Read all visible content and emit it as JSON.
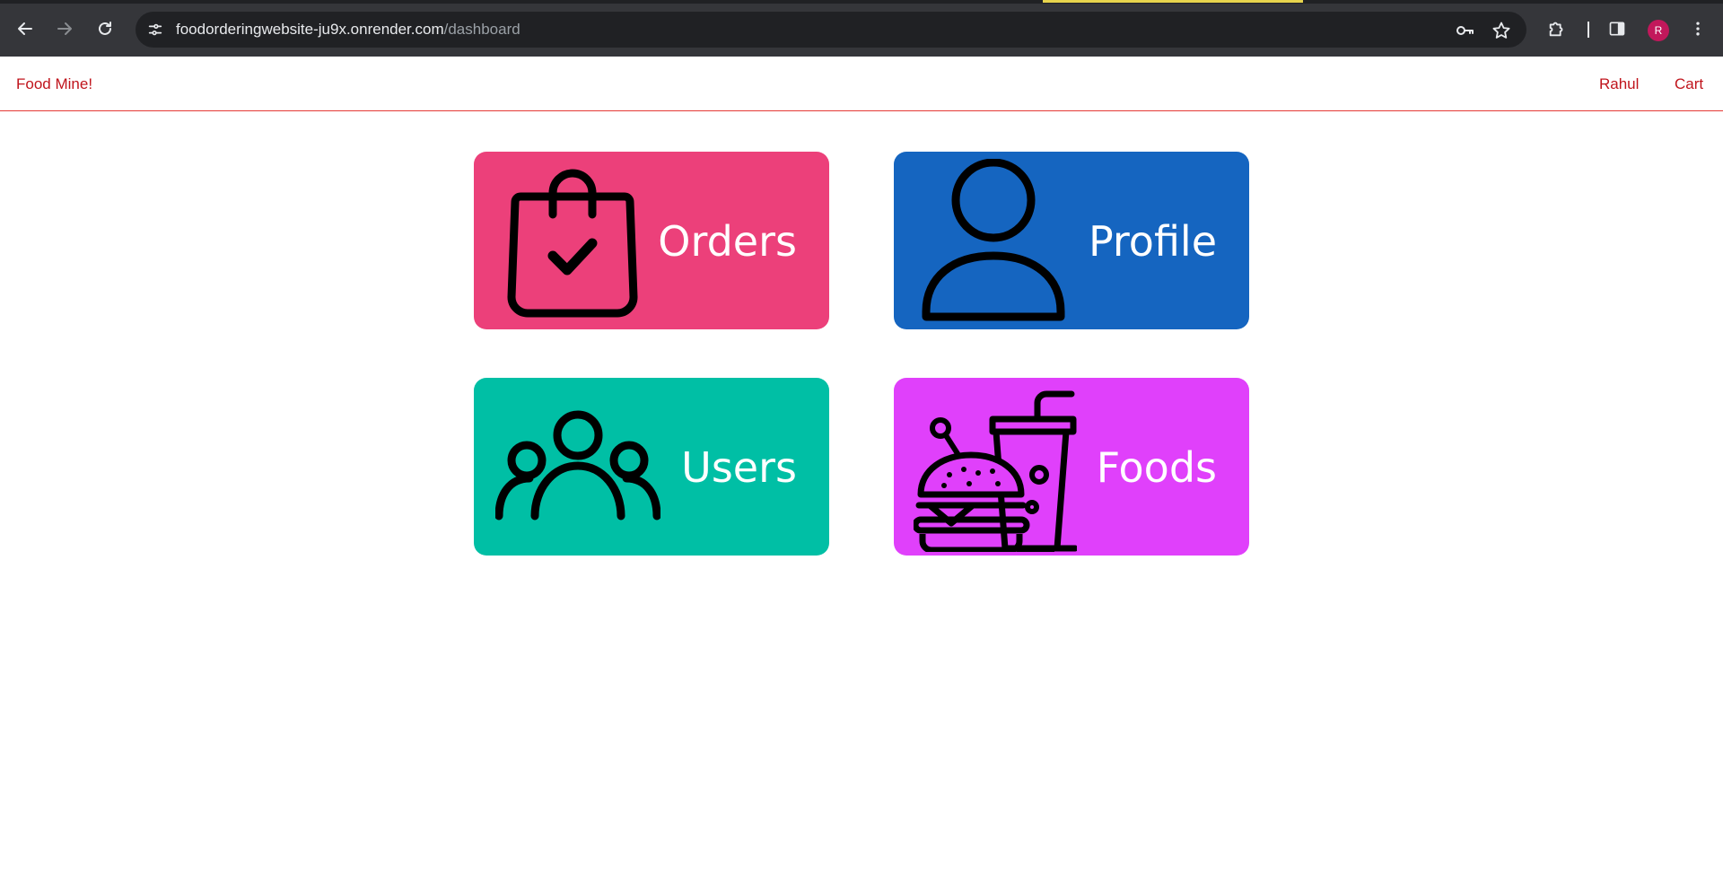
{
  "browser": {
    "url_host": "foodorderingwebsite-ju9x.onrender.com",
    "url_path": "/dashboard",
    "profile_initial": "R",
    "icons": {
      "back": "back-arrow-icon",
      "forward": "forward-arrow-icon",
      "reload": "reload-icon",
      "site_info": "tune-icon",
      "password": "key-icon",
      "bookmark": "star-icon",
      "extensions": "puzzle-icon",
      "side_panel": "side-panel-icon",
      "menu": "kebab-menu-icon"
    }
  },
  "header": {
    "brand": "Food Mine!",
    "nav": [
      "Rahul",
      "Cart"
    ],
    "accent_color": "#c0141c"
  },
  "dashboard": {
    "cards": [
      {
        "label": "Orders",
        "icon": "shopping-bag-check-icon",
        "color": "#ec407a"
      },
      {
        "label": "Profile",
        "icon": "person-icon",
        "color": "#1565c0"
      },
      {
        "label": "Users",
        "icon": "users-group-icon",
        "color": "#00bfa5"
      },
      {
        "label": "Foods",
        "icon": "burger-drink-icon",
        "color": "#e040fb"
      }
    ]
  }
}
